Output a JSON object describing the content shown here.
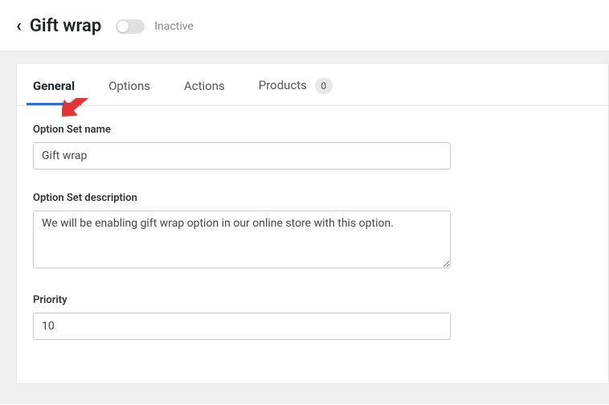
{
  "header": {
    "title": "Gift wrap",
    "toggle_state": "off",
    "status_label": "Inactive"
  },
  "tabs": [
    {
      "label": "General",
      "active": true
    },
    {
      "label": "Options",
      "active": false
    },
    {
      "label": "Actions",
      "active": false
    },
    {
      "label": "Products",
      "active": false,
      "badge": "0"
    }
  ],
  "form": {
    "name_label": "Option Set name",
    "name_value": "Gift wrap",
    "desc_label": "Option Set description",
    "desc_value": "We will be enabling gift wrap option in our online store with this option.",
    "priority_label": "Priority",
    "priority_value": "10"
  }
}
